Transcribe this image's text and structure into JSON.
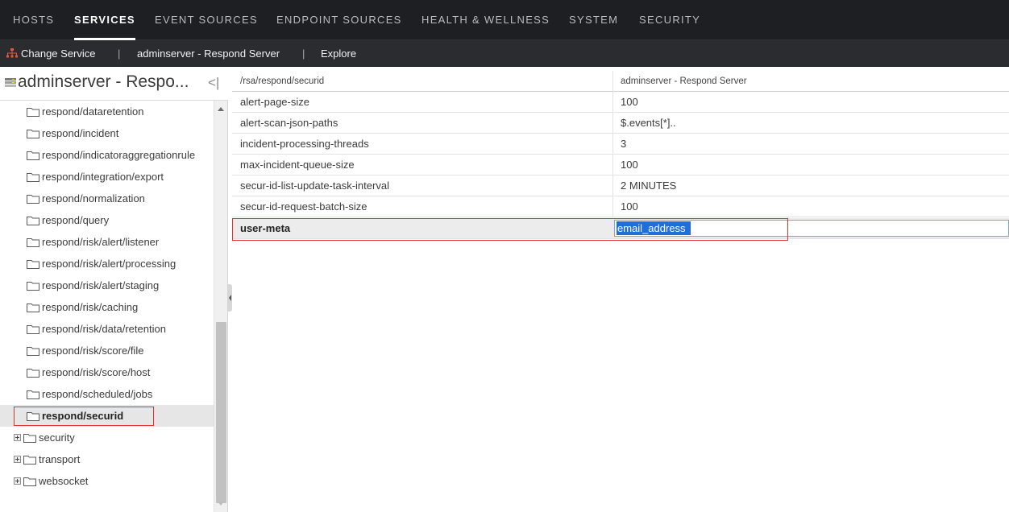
{
  "nav": {
    "tabs": [
      {
        "label": "HOSTS"
      },
      {
        "label": "SERVICES"
      },
      {
        "label": "EVENT SOURCES"
      },
      {
        "label": "ENDPOINT SOURCES"
      },
      {
        "label": "HEALTH & WELLNESS"
      },
      {
        "label": "SYSTEM"
      },
      {
        "label": "SECURITY"
      }
    ],
    "active": "SERVICES"
  },
  "toolbar": {
    "change_service": "Change Service",
    "separator": "|",
    "service_name": "adminserver - Respond Server",
    "explore": "Explore"
  },
  "left_panel": {
    "title": "adminserver - Respo...",
    "collapse_glyph": "<|",
    "tree": [
      {
        "label": "respond/dataretention",
        "expandable": false
      },
      {
        "label": "respond/incident",
        "expandable": false
      },
      {
        "label": "respond/indicatoraggregationrule",
        "expandable": false
      },
      {
        "label": "respond/integration/export",
        "expandable": false
      },
      {
        "label": "respond/normalization",
        "expandable": false
      },
      {
        "label": "respond/query",
        "expandable": false
      },
      {
        "label": "respond/risk/alert/listener",
        "expandable": false
      },
      {
        "label": "respond/risk/alert/processing",
        "expandable": false
      },
      {
        "label": "respond/risk/alert/staging",
        "expandable": false
      },
      {
        "label": "respond/risk/caching",
        "expandable": false
      },
      {
        "label": "respond/risk/data/retention",
        "expandable": false
      },
      {
        "label": "respond/risk/score/file",
        "expandable": false
      },
      {
        "label": "respond/risk/score/host",
        "expandable": false
      },
      {
        "label": "respond/scheduled/jobs",
        "expandable": false
      },
      {
        "label": "respond/securid",
        "expandable": false,
        "selected": true
      },
      {
        "label": "security",
        "expandable": true
      },
      {
        "label": "transport",
        "expandable": true
      },
      {
        "label": "websocket",
        "expandable": true
      }
    ]
  },
  "grid": {
    "header": {
      "path": "/rsa/respond/securid",
      "service": "adminserver - Respond Server"
    },
    "rows": [
      {
        "name": "alert-page-size",
        "value": "100"
      },
      {
        "name": "alert-scan-json-paths",
        "value": "$.events[*].."
      },
      {
        "name": "incident-processing-threads",
        "value": "3"
      },
      {
        "name": "max-incident-queue-size",
        "value": "100"
      },
      {
        "name": "secur-id-list-update-task-interval",
        "value": "2 MINUTES"
      },
      {
        "name": "secur-id-request-batch-size",
        "value": "100"
      }
    ],
    "editing_row": {
      "name": "user-meta",
      "value": "email_address"
    }
  },
  "colors": {
    "nav_bg": "#1d1f22",
    "toolbar_bg": "#2a2c30",
    "highlight_red": "#e0322f",
    "selection_blue": "#1e6fd9"
  }
}
